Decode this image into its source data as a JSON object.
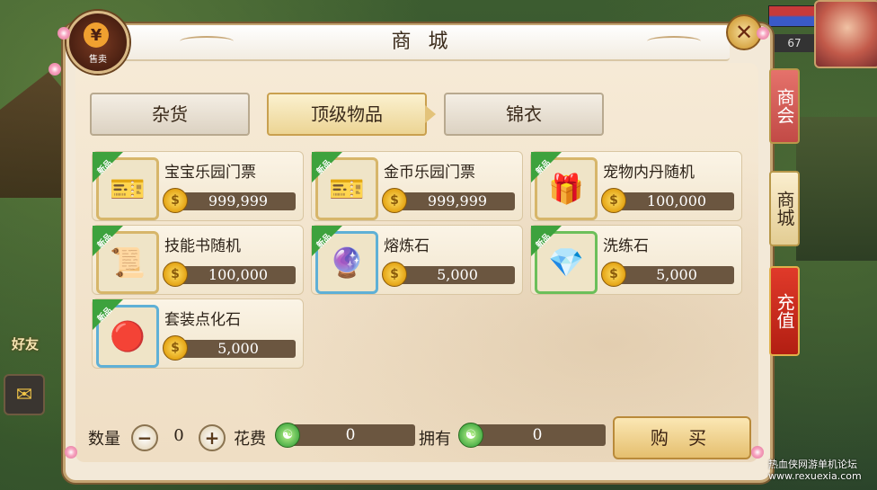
{
  "window": {
    "title": "商 城"
  },
  "sell_emblem": {
    "icon": "yen-icon",
    "label": "售卖"
  },
  "close_button": {
    "icon": "close-icon"
  },
  "categories": [
    {
      "label": "杂货",
      "active": false
    },
    {
      "label": "顶级物品",
      "active": true
    },
    {
      "label": "锦衣",
      "active": false
    }
  ],
  "new_tag": "新品",
  "items": [
    {
      "name": "宝宝乐园门票",
      "price": "999,999",
      "icon": "ticket-icon",
      "border": "gold"
    },
    {
      "name": "金币乐园门票",
      "price": "999,999",
      "icon": "ticket-icon",
      "border": "gold"
    },
    {
      "name": "宠物内丹随机",
      "price": "100,000",
      "icon": "gift-box-icon",
      "border": "gold"
    },
    {
      "name": "技能书随机",
      "price": "100,000",
      "icon": "scroll-icon",
      "border": "gold"
    },
    {
      "name": "熔炼石",
      "price": "5,000",
      "icon": "purple-orb-icon",
      "border": "blue"
    },
    {
      "name": "洗练石",
      "price": "5,000",
      "icon": "crystal-ore-icon",
      "border": "green"
    },
    {
      "name": "套装点化石",
      "price": "5,000",
      "icon": "red-orb-icon",
      "border": "blue"
    }
  ],
  "bottom": {
    "quantity_label": "数量",
    "quantity_value": "0",
    "cost_label": "花费",
    "cost_value": "0",
    "own_label": "拥有",
    "own_value": "0",
    "buy_label": "购 买"
  },
  "side_tabs": [
    {
      "label": "商会"
    },
    {
      "label": "商城"
    },
    {
      "label": "充值"
    }
  ],
  "left_widgets": {
    "friend_label": "好友"
  },
  "hud": {
    "level": "67"
  },
  "watermark": {
    "line1": "热血侠网游单机论坛",
    "line2": "www.rexuexia.com"
  },
  "colors": {
    "panel_bg": "#f3e9d8",
    "price_bar": "#6b5640",
    "active_tab": "#ecd494",
    "new_tag": "#3da23d",
    "recharge_tab": "#c0251a"
  }
}
